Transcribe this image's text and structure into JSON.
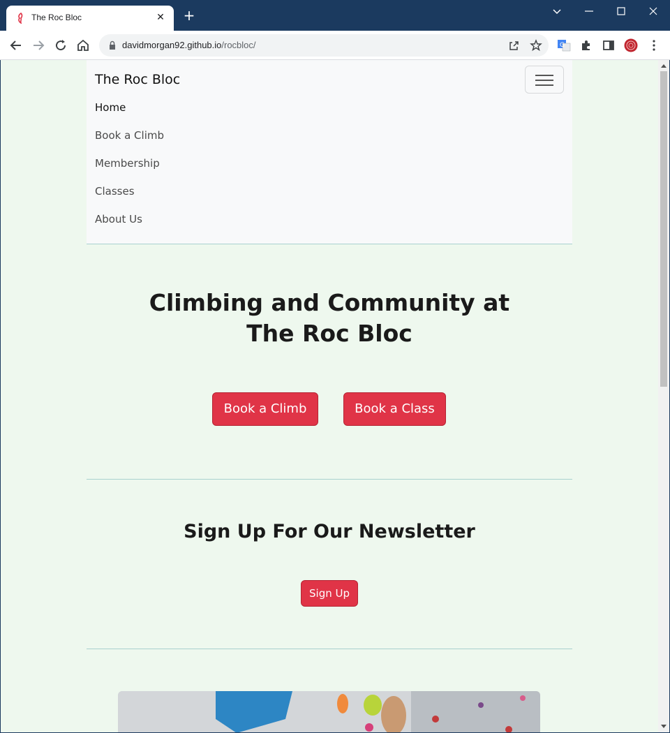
{
  "browser": {
    "tab_title": "The Roc Bloc",
    "url_host": "davidmorgan92.github.io",
    "url_path": "/rocbloc/",
    "tab_close": "✕",
    "new_tab": "+",
    "icons": [
      "back-icon",
      "forward-icon",
      "reload-icon",
      "home-icon",
      "lock-icon",
      "share-icon",
      "star-icon",
      "translate-icon",
      "extensions-icon",
      "sidepanel-icon",
      "profile-avatar",
      "menu-icon"
    ]
  },
  "navbar": {
    "brand": "The Roc Bloc",
    "items": [
      {
        "label": "Home",
        "active": true
      },
      {
        "label": "Book a Climb"
      },
      {
        "label": "Membership"
      },
      {
        "label": "Classes"
      },
      {
        "label": "About Us"
      }
    ]
  },
  "hero": {
    "title_line1": "Climbing and Community at",
    "title_line2": "The Roc Bloc",
    "btn_climb": "Book a Climb",
    "btn_class": "Book a Class"
  },
  "newsletter": {
    "title": "Sign Up For Our Newsletter",
    "btn_signup": "Sign Up"
  },
  "colors": {
    "accent": "#e03447",
    "page_bg": "#eef8ee",
    "titlebar": "#1b3a5f"
  }
}
